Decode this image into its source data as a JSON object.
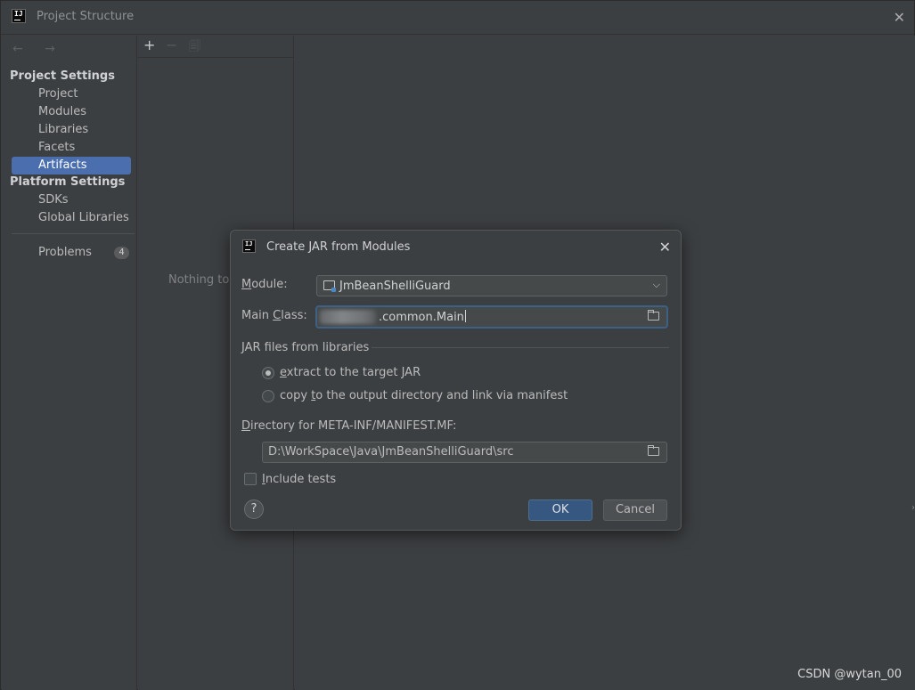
{
  "window": {
    "title": "Project Structure",
    "close_glyph": "✕",
    "logo_text": "IJ"
  },
  "sidebar": {
    "nav_arrows": "← →",
    "project_settings_header": "Project Settings",
    "project_items": [
      {
        "label": "Project",
        "selected": false
      },
      {
        "label": "Modules",
        "selected": false
      },
      {
        "label": "Libraries",
        "selected": false
      },
      {
        "label": "Facets",
        "selected": false
      },
      {
        "label": "Artifacts",
        "selected": true
      }
    ],
    "platform_settings_header": "Platform Settings",
    "platform_items": [
      {
        "label": "SDKs"
      },
      {
        "label": "Global Libraries"
      }
    ],
    "problems_label": "Problems",
    "problems_count": "4"
  },
  "middle_panel": {
    "toolbar": {
      "add": "+",
      "remove": "−",
      "copy": "🗐"
    },
    "empty_text": "Nothing to"
  },
  "dialog": {
    "title": "Create JAR from Modules",
    "close_glyph": "✕",
    "module_label": {
      "prefix": "",
      "mnemonic": "M",
      "rest": "odule:"
    },
    "module_value": "JmBeanShelliGuard",
    "main_class_label": {
      "prefix": "Main ",
      "mnemonic": "C",
      "rest": "lass:"
    },
    "main_class_value": ".common.Main",
    "jar_group_label": "JAR files from libraries",
    "radio_extract": {
      "mnemonic": "e",
      "rest": "xtract to the target JAR",
      "checked": true
    },
    "radio_copy": {
      "prefix": "copy ",
      "mnemonic": "t",
      "rest": "o the output directory and link via manifest",
      "checked": false
    },
    "manifest_dir_label": {
      "mnemonic": "D",
      "rest": "irectory for META-INF/MANIFEST.MF:"
    },
    "manifest_dir_value": "D:\\WorkSpace\\Java\\JmBeanShelliGuard\\src",
    "include_tests": {
      "mnemonic": "I",
      "rest": "nclude tests",
      "checked": false
    },
    "help_glyph": "?",
    "ok_label": "OK",
    "cancel_label": "Cancel"
  },
  "watermark": "CSDN @wytan_00",
  "colors": {
    "background": "#3c3f41",
    "selection": "#4b6eaf",
    "ok_button": "#365880",
    "focus_border": "#3d6185"
  }
}
